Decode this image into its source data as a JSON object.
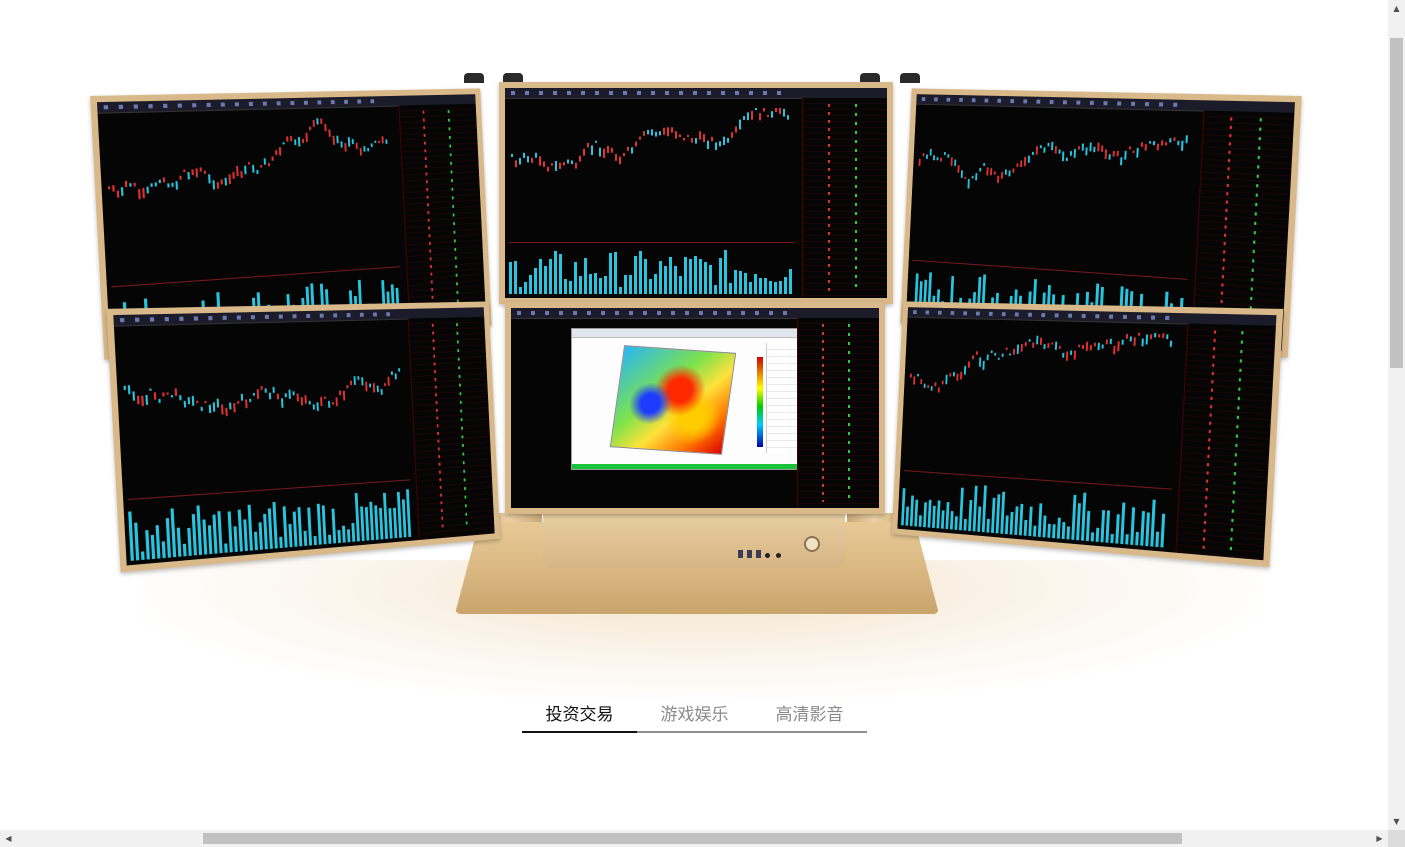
{
  "tabs": [
    {
      "label": "投资交易",
      "active": true
    },
    {
      "label": "游戏娱乐",
      "active": false
    },
    {
      "label": "高清影音",
      "active": false
    }
  ],
  "product": {
    "description_icon": "six-screen-trading-display-icon",
    "screen_count": 6,
    "accent_color": "#d9b98a",
    "chart_candle_colors": [
      "#27c6e0",
      "#e23131"
    ]
  },
  "scrollbars": {
    "up_arrow": "▲",
    "down_arrow": "▼",
    "left_arrow": "◀",
    "right_arrow": "▶"
  }
}
